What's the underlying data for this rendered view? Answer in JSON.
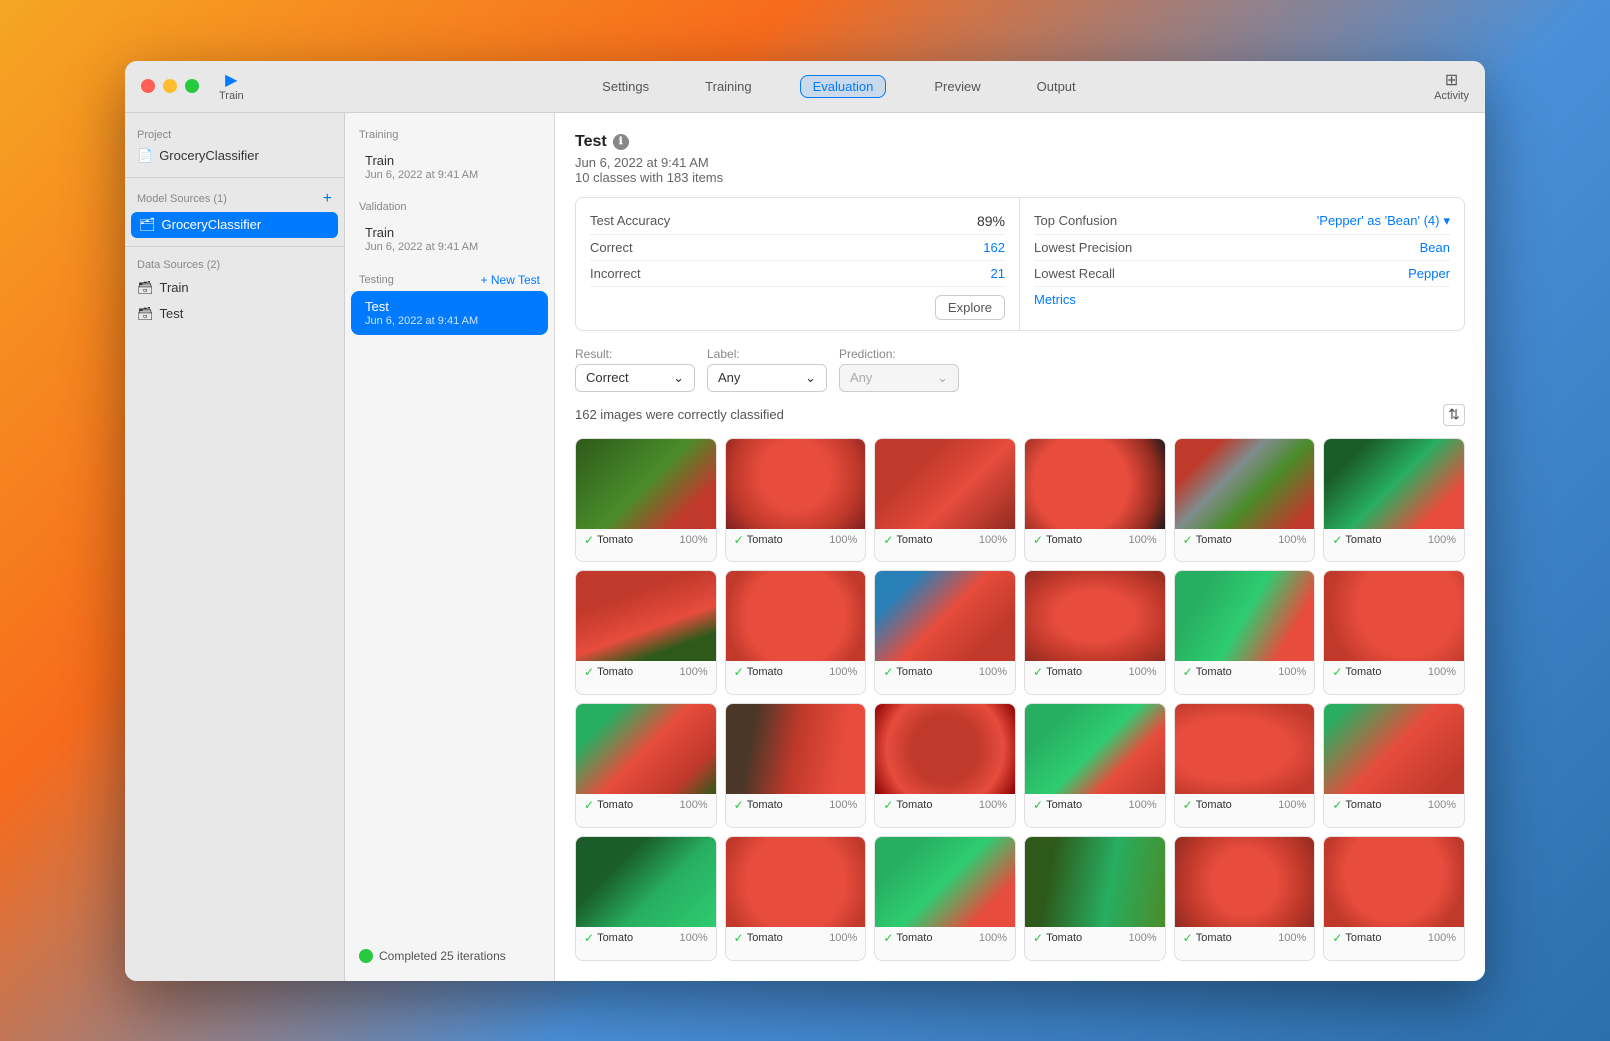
{
  "window": {
    "title": "GroceryClassifier"
  },
  "sidebar": {
    "project_label": "Project",
    "project_name": "GroceryClassifier",
    "model_sources_label": "Model Sources (1)",
    "model_name": "GroceryClassifier",
    "data_sources_label": "Data Sources (2)",
    "data_train": "Train",
    "data_test": "Test"
  },
  "toolbar": {
    "train_label": "Train",
    "settings_label": "Settings",
    "training_label": "Training",
    "evaluation_label": "Evaluation",
    "preview_label": "Preview",
    "output_label": "Output",
    "activity_label": "Activity"
  },
  "panel": {
    "training_label": "Training",
    "training_item_title": "Train",
    "training_item_date": "Jun 6, 2022 at 9:41 AM",
    "validation_label": "Validation",
    "validation_item_title": "Train",
    "validation_item_date": "Jun 6, 2022 at 9:41 AM",
    "testing_label": "Testing",
    "new_test_label": "+ New Test",
    "test_item_title": "Test",
    "test_item_date": "Jun 6, 2022 at 9:41 AM",
    "status_text": "Completed 25 iterations"
  },
  "main": {
    "test_title": "Test",
    "test_date": "Jun 6, 2022 at 9:41 AM",
    "test_classes": "10 classes with 183 items",
    "metrics": {
      "test_accuracy_label": "Test Accuracy",
      "test_accuracy_value": "89%",
      "correct_label": "Correct",
      "correct_value": "162",
      "incorrect_label": "Incorrect",
      "incorrect_value": "21",
      "explore_label": "Explore",
      "top_confusion_label": "Top Confusion",
      "top_confusion_value": "'Pepper' as 'Bean' (4)",
      "lowest_precision_label": "Lowest Precision",
      "lowest_precision_value": "Bean",
      "lowest_recall_label": "Lowest Recall",
      "lowest_recall_value": "Pepper",
      "metrics_label": "Metrics"
    },
    "filters": {
      "result_label": "Result:",
      "result_value": "Correct",
      "label_label": "Label:",
      "label_value": "Any",
      "prediction_label": "Prediction:",
      "prediction_value": "Any"
    },
    "results_count": "162 images were correctly classified",
    "images": [
      {
        "label": "Tomato",
        "confidence": "100%",
        "style": "thumb-tomato-1"
      },
      {
        "label": "Tomato",
        "confidence": "100%",
        "style": "thumb-tomato-2"
      },
      {
        "label": "Tomato",
        "confidence": "100%",
        "style": "thumb-tomato-3"
      },
      {
        "label": "Tomato",
        "confidence": "100%",
        "style": "thumb-tomato-4"
      },
      {
        "label": "Tomato",
        "confidence": "100%",
        "style": "thumb-tomato-5"
      },
      {
        "label": "Tomato",
        "confidence": "100%",
        "style": "thumb-tomato-6"
      },
      {
        "label": "Tomato",
        "confidence": "100%",
        "style": "thumb-tomato-7"
      },
      {
        "label": "Tomato",
        "confidence": "100%",
        "style": "thumb-tomato-8"
      },
      {
        "label": "Tomato",
        "confidence": "100%",
        "style": "thumb-tomato-9"
      },
      {
        "label": "Tomato",
        "confidence": "100%",
        "style": "thumb-tomato-10"
      },
      {
        "label": "Tomato",
        "confidence": "100%",
        "style": "thumb-tomato-11"
      },
      {
        "label": "Tomato",
        "confidence": "100%",
        "style": "thumb-tomato-12"
      },
      {
        "label": "Tomato",
        "confidence": "100%",
        "style": "thumb-tomato-13"
      },
      {
        "label": "Tomato",
        "confidence": "100%",
        "style": "thumb-tomato-14"
      },
      {
        "label": "Tomato",
        "confidence": "100%",
        "style": "thumb-tomato-15"
      },
      {
        "label": "Tomato",
        "confidence": "100%",
        "style": "thumb-tomato-16"
      },
      {
        "label": "Tomato",
        "confidence": "100%",
        "style": "thumb-tomato-17"
      },
      {
        "label": "Tomato",
        "confidence": "100%",
        "style": "thumb-tomato-18"
      },
      {
        "label": "Tomato",
        "confidence": "100%",
        "style": "thumb-tomato-r1"
      },
      {
        "label": "Tomato",
        "confidence": "100%",
        "style": "thumb-tomato-r2"
      },
      {
        "label": "Tomato",
        "confidence": "100%",
        "style": "thumb-tomato-r3"
      },
      {
        "label": "Tomato",
        "confidence": "100%",
        "style": "thumb-tomato-r4"
      },
      {
        "label": "Tomato",
        "confidence": "100%",
        "style": "thumb-tomato-r5"
      },
      {
        "label": "Tomato",
        "confidence": "100%",
        "style": "thumb-tomato-r6"
      }
    ]
  }
}
